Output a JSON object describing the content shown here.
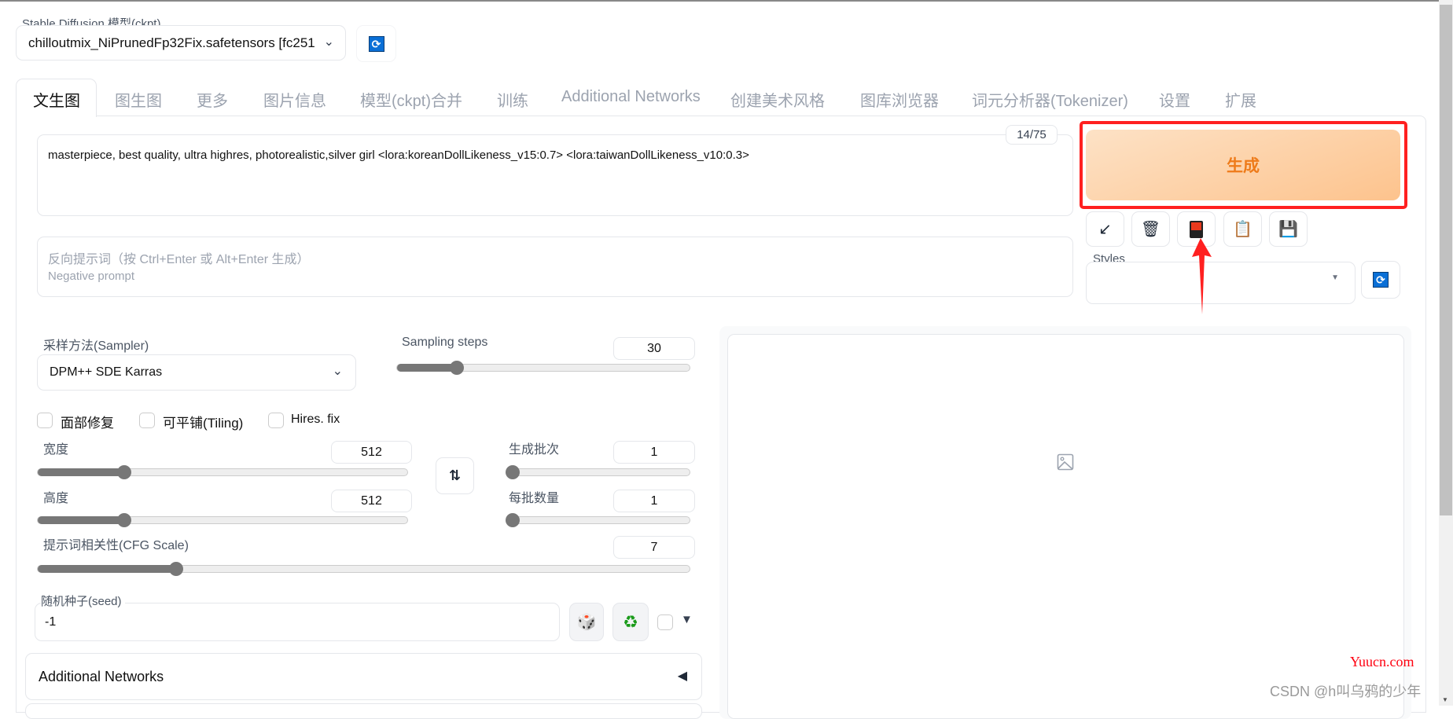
{
  "model": {
    "label": "Stable Diffusion 模型(ckpt)",
    "value": "chilloutmix_NiPrunedFp32Fix.safetensors [fc251"
  },
  "tabs": [
    "文生图",
    "图生图",
    "更多",
    "图片信息",
    "模型(ckpt)合并",
    "训练",
    "Additional Networks",
    "创建美术风格",
    "图库浏览器",
    "词元分析器(Tokenizer)",
    "设置",
    "扩展"
  ],
  "active_tab": "文生图",
  "prompt": {
    "value": "masterpiece, best quality, ultra highres, photorealistic,silver girl <lora:koreanDollLikeness_v15:0.7> <lora:taiwanDollLikeness_v10:0.3>",
    "token_count": "14/75"
  },
  "negative": {
    "placeholder_line1": "反向提示词（按 Ctrl+Enter 或 Alt+Enter 生成）",
    "placeholder_line2": "Negative prompt"
  },
  "generate_label": "生成",
  "tool_buttons": [
    "arrow-icon",
    "trash-icon",
    "card-icon",
    "clipboard-icon",
    "save-icon"
  ],
  "styles": {
    "label": "Styles",
    "value": ""
  },
  "sampler": {
    "label": "采样方法(Sampler)",
    "value": "DPM++ SDE Karras"
  },
  "steps": {
    "label": "Sampling steps",
    "value": "30",
    "min": 1,
    "max": 150
  },
  "checkboxes": [
    {
      "label": "面部修复",
      "checked": false
    },
    {
      "label": "可平铺(Tiling)",
      "checked": false
    },
    {
      "label": "Hires. fix",
      "checked": false
    }
  ],
  "width": {
    "label": "宽度",
    "value": "512",
    "min": 64,
    "max": 2048
  },
  "height": {
    "label": "高度",
    "value": "512",
    "min": 64,
    "max": 2048
  },
  "batch_count": {
    "label": "生成批次",
    "value": "1",
    "min": 1,
    "max": 100
  },
  "batch_size": {
    "label": "每批数量",
    "value": "1",
    "min": 1,
    "max": 8
  },
  "cfg": {
    "label": "提示词相关性(CFG Scale)",
    "value": "7",
    "min": 1,
    "max": 30
  },
  "seed": {
    "label": "随机种子(seed)",
    "value": "-1"
  },
  "additional_networks": {
    "label": "Additional Networks"
  },
  "watermarks": {
    "site": "Yuucn.com",
    "author": "CSDN @h叫乌鸦的少年"
  },
  "colors": {
    "accent_orange": "#ee7b1a",
    "highlight_red": "#ff2020",
    "refresh_blue": "#0a6fd6"
  }
}
